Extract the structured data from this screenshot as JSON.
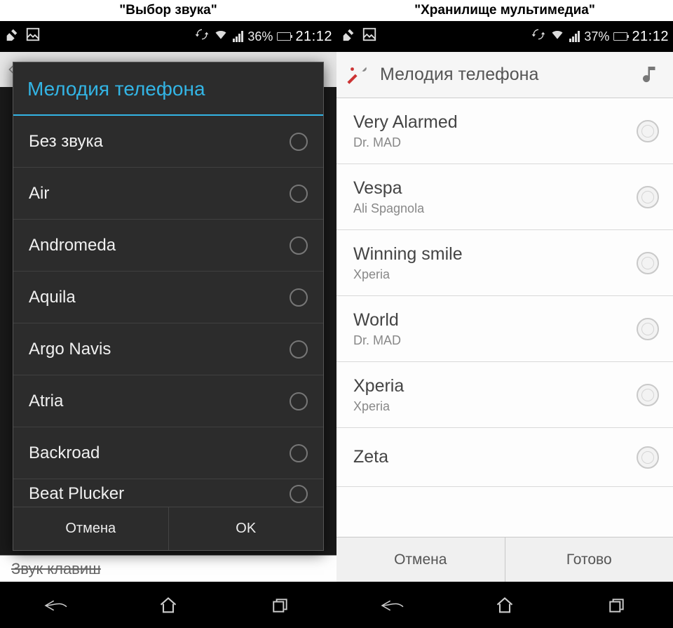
{
  "left": {
    "caption": "\"Выбор звука\"",
    "status": {
      "battery_pct": "36%",
      "time": "21:12"
    },
    "dialog": {
      "title": "Мелодия телефона",
      "items": [
        {
          "label": "Без звука"
        },
        {
          "label": "Air"
        },
        {
          "label": "Andromeda"
        },
        {
          "label": "Aquila"
        },
        {
          "label": "Argo Navis"
        },
        {
          "label": "Atria"
        },
        {
          "label": "Backroad"
        },
        {
          "label": "Beat Plucker"
        }
      ],
      "cancel": "Отмена",
      "ok": "OK"
    },
    "background_bottom_text": "Звук клавиш"
  },
  "right": {
    "caption": "\"Хранилище мультимедиа\"",
    "status": {
      "battery_pct": "37%",
      "time": "21:12"
    },
    "header": "Мелодия телефона",
    "items": [
      {
        "title": "Very Alarmed",
        "artist": "Dr. MAD"
      },
      {
        "title": "Vespa",
        "artist": "Ali Spagnola"
      },
      {
        "title": "Winning smile",
        "artist": "Xperia"
      },
      {
        "title": "World",
        "artist": "Dr. MAD"
      },
      {
        "title": "Xperia",
        "artist": "Xperia"
      },
      {
        "title": "Zeta",
        "artist": ""
      }
    ],
    "cancel": "Отмена",
    "done": "Готово"
  }
}
